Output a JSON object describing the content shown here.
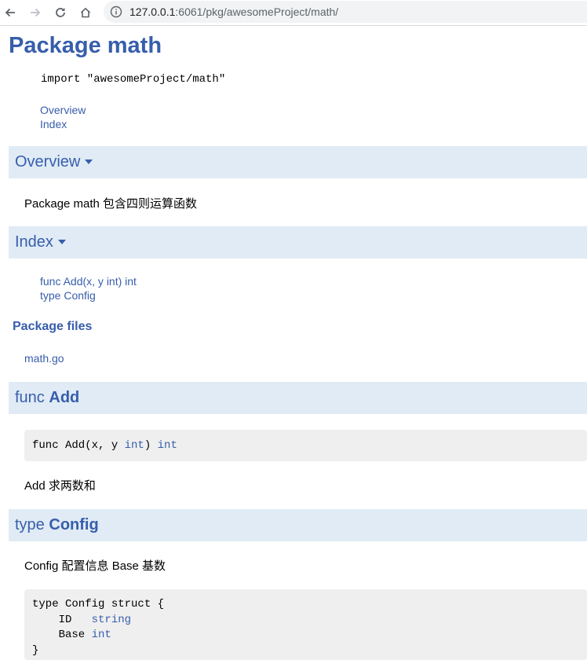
{
  "browser": {
    "url_host": "127.0.0.1",
    "url_rest": ":6061/pkg/awesomeProject/math/",
    "back_icon": "arrow-left-icon",
    "forward_icon": "arrow-right-icon",
    "reload_icon": "reload-icon",
    "home_icon": "home-icon",
    "info_icon": "info-icon"
  },
  "page": {
    "title": "Package math",
    "import_line": "import \"awesomeProject/math\"",
    "toc": [
      "Overview",
      "Index"
    ],
    "overview": {
      "heading": "Overview",
      "text": "Package math 包含四则运算函数"
    },
    "index": {
      "heading": "Index",
      "items": [
        "func Add(x, y int) int",
        "type Config"
      ]
    },
    "package_files": {
      "heading": "Package files",
      "files": [
        "math.go"
      ]
    },
    "func_add": {
      "prefix": "func",
      "name": "Add",
      "sig_start": "func Add(x, y ",
      "sig_type1": "int",
      "sig_mid": ") ",
      "sig_type2": "int",
      "doc": "Add 求两数和"
    },
    "type_config": {
      "prefix": "type",
      "name": "Config",
      "doc": "Config 配置信息 Base 基数",
      "line1": "type Config struct {",
      "f1_name": "    ID   ",
      "f1_type": "string",
      "f2_name": "    Base ",
      "f2_type": "int",
      "line_end": "}"
    }
  },
  "colors": {
    "link": "#375eab",
    "section_bg": "#e0ebf5",
    "code_bg": "#efefef"
  }
}
